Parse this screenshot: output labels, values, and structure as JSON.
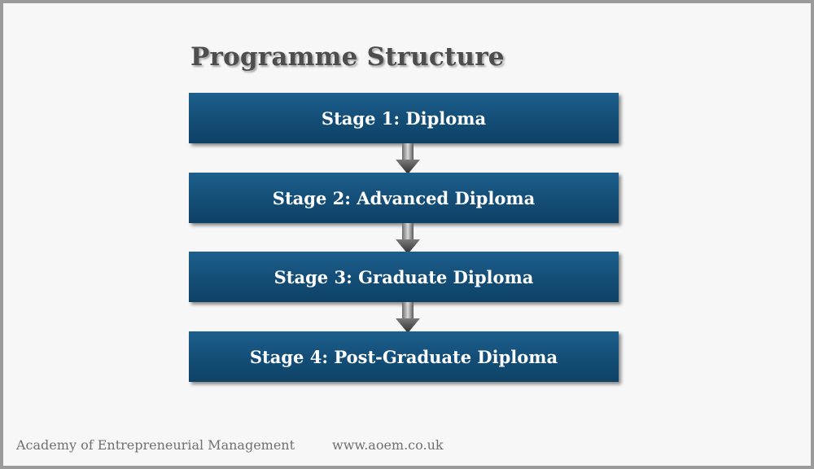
{
  "title": "Programme Structure",
  "stages": [
    {
      "label": "Stage 1: Diploma"
    },
    {
      "label": "Stage 2: Advanced Diploma"
    },
    {
      "label": "Stage 3: Graduate Diploma"
    },
    {
      "label": "Stage 4: Post-Graduate Diploma"
    }
  ],
  "footer": {
    "organization": "Academy of Entrepreneurial Management",
    "website": "www.aoem.co.uk"
  },
  "colors": {
    "stage_fill": "#134d76",
    "stage_text": "#ffffff",
    "title_text": "#4d4d4d",
    "footer_text": "#707070",
    "arrow": "#555555"
  }
}
